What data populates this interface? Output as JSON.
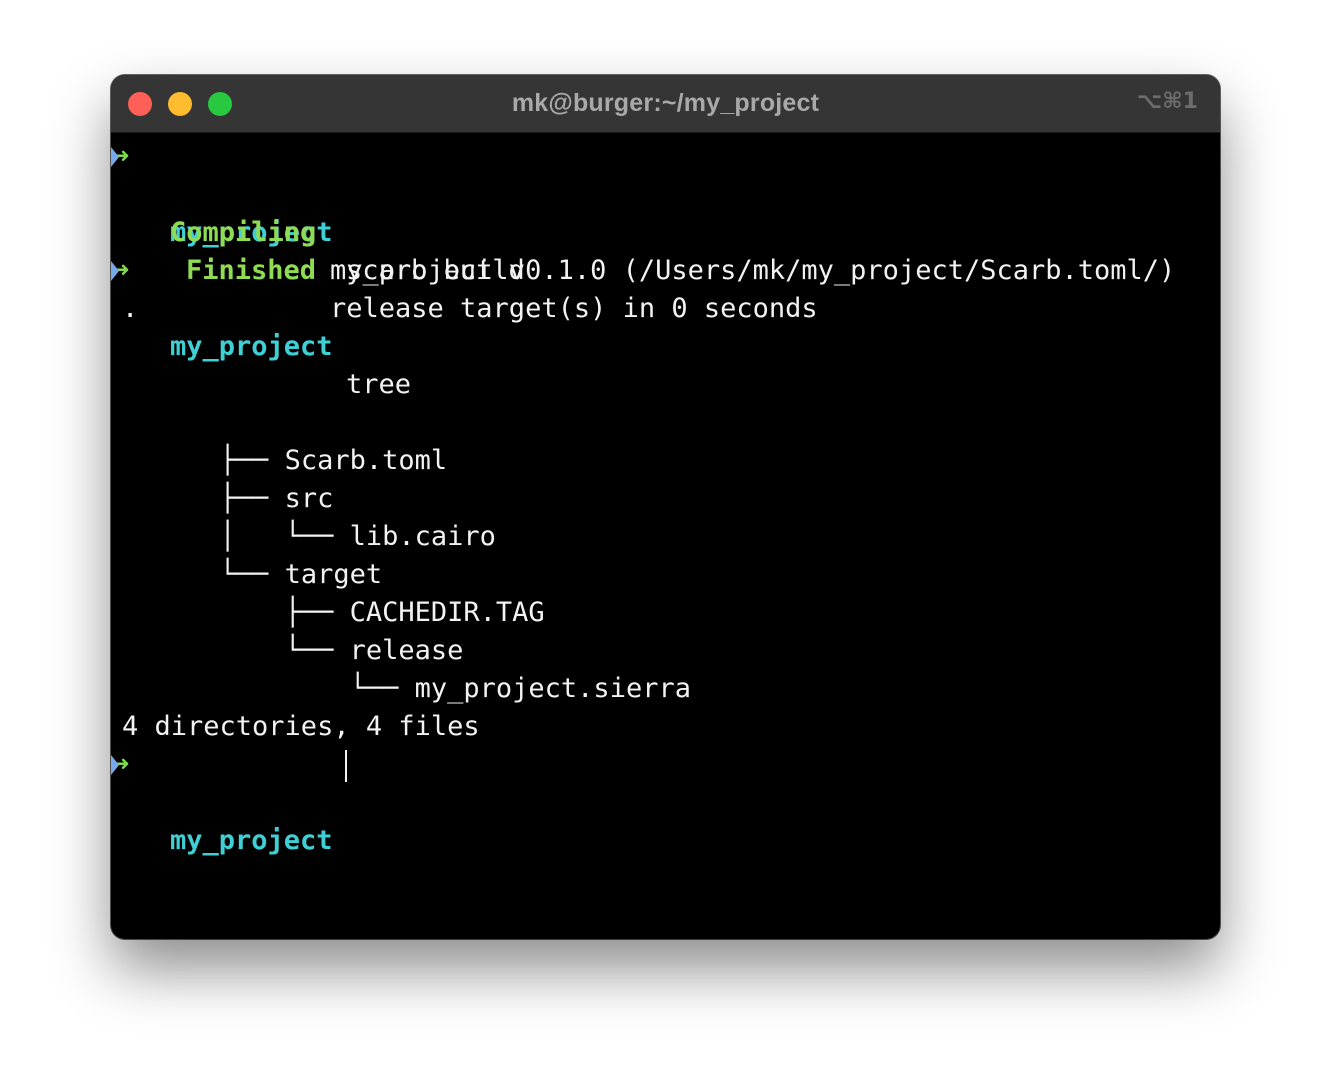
{
  "window": {
    "title": "mk@burger:~/my_project",
    "shortcut": "⌥⌘1"
  },
  "prompt": {
    "arrow": "➜",
    "dir": "my_project"
  },
  "commands": {
    "build": "scarb build",
    "tree": "tree"
  },
  "build_output": {
    "compiling_label": "Compiling",
    "compiling_text": "my_project v0.1.0 (/Users/mk/my_project/Scarb.toml/)",
    "finished_label": "Finished",
    "finished_text": "release target(s) in 0 seconds"
  },
  "tree_output": {
    "root": ".",
    "items": [
      {
        "prefix": "├── ",
        "name": "Scarb.toml"
      },
      {
        "prefix": "├── ",
        "name": "src"
      },
      {
        "prefix": "│   └── ",
        "name": "lib.cairo"
      },
      {
        "prefix": "└── ",
        "name": "target"
      },
      {
        "prefix": "    ├── ",
        "name": "CACHEDIR.TAG"
      },
      {
        "prefix": "    └── ",
        "name": "release"
      },
      {
        "prefix": "        └── ",
        "name": "my_project.sierra"
      }
    ],
    "summary": "4 directories, 4 files"
  },
  "colors": {
    "prompt_dir": "#3fd0d6",
    "status_label": "#8fdc54",
    "arrow": "#7fd94a",
    "background": "#000000"
  }
}
